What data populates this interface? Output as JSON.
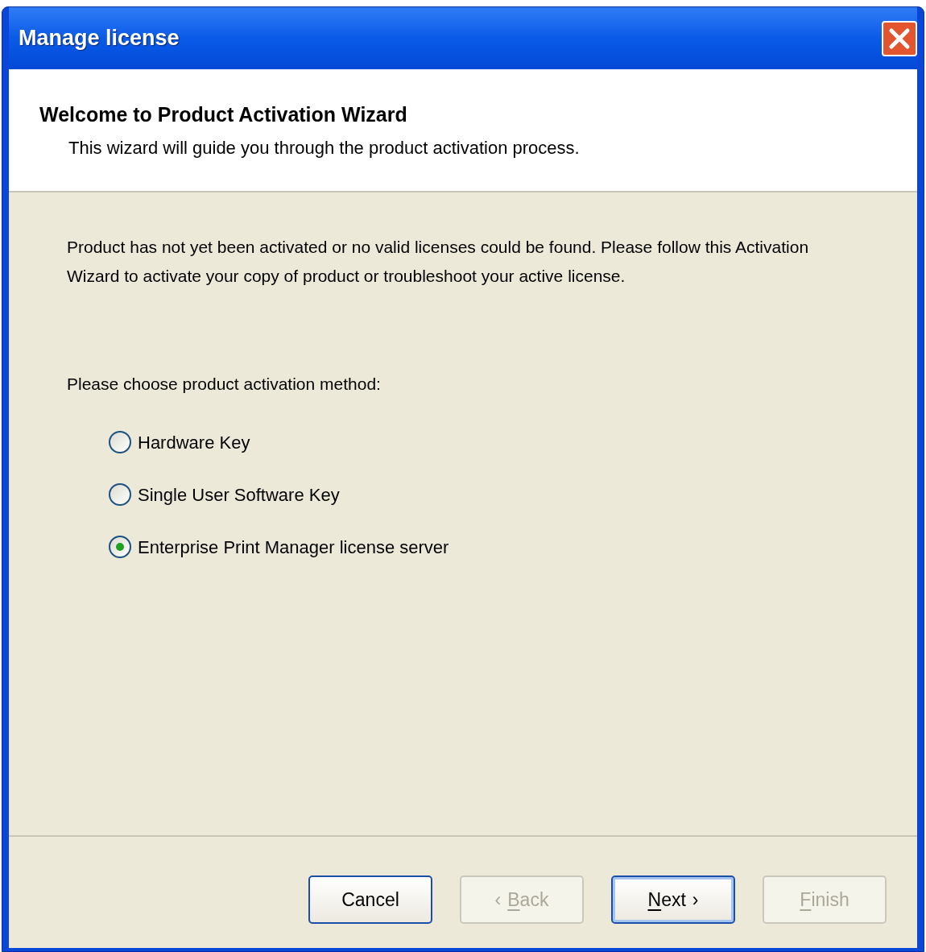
{
  "window": {
    "title": "Manage license"
  },
  "header": {
    "title": "Welcome to Product Activation Wizard",
    "subtitle": "This wizard will guide you through the product activation process."
  },
  "message": "Product has not yet been activated or no valid licenses could be found. Please follow this Activation Wizard to activate your copy of product or troubleshoot your active license.",
  "prompt": "Please choose product activation method:",
  "options": [
    {
      "label": "Hardware Key",
      "selected": false
    },
    {
      "label": "Single User Software Key",
      "selected": false
    },
    {
      "label": "Enterprise Print Manager license server",
      "selected": true
    }
  ],
  "buttons": [
    {
      "label": "Cancel",
      "mnemonic": false,
      "disabled": false,
      "focused": false
    },
    {
      "before": "‹",
      "label": "Back",
      "mnemonic": true,
      "disabled": true,
      "focused": false
    },
    {
      "label": "Next",
      "after": "›",
      "mnemonic": true,
      "disabled": false,
      "focused": true
    },
    {
      "label": "Finish",
      "mnemonic": true,
      "disabled": true,
      "focused": false
    }
  ]
}
